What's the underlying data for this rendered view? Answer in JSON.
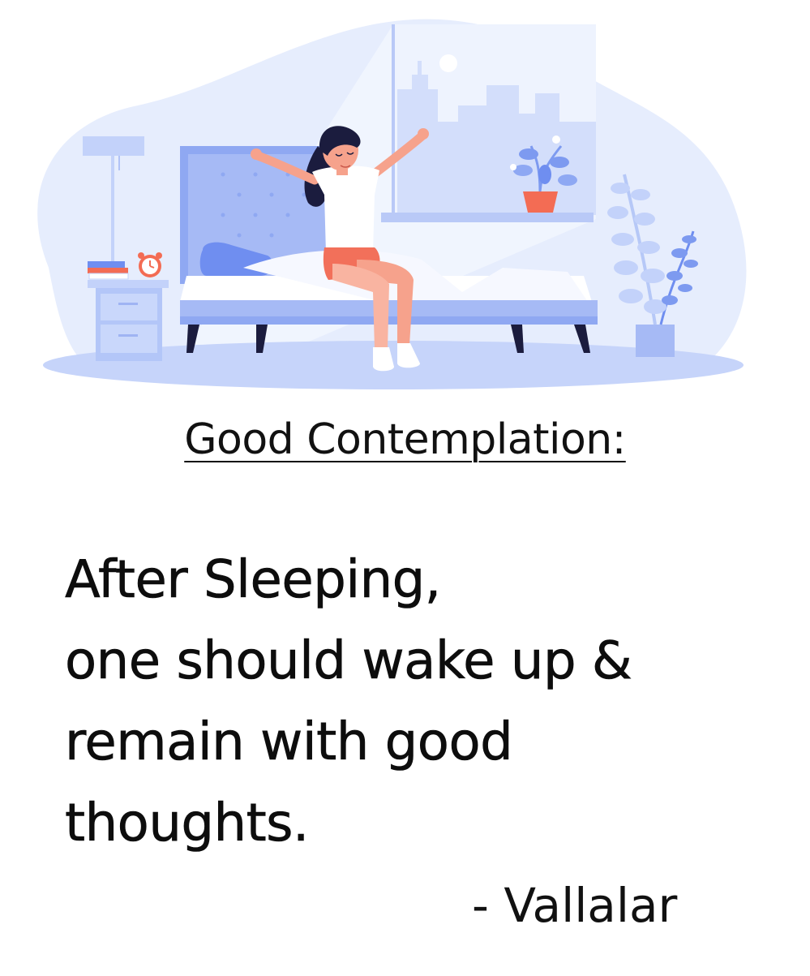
{
  "heading": "Good Contemplation:",
  "quote_lines": [
    "After Sleeping,",
    "one should wake up &",
    "remain with good",
    "thoughts."
  ],
  "author": "- Vallalar",
  "colors": {
    "background": "#ffffff",
    "blob": "#e3ebfd",
    "accent": "#6f8ef0",
    "skin": "#f6a28c",
    "shorts": "#f2705a",
    "hair": "#1b1c3e",
    "text": "#111111"
  }
}
